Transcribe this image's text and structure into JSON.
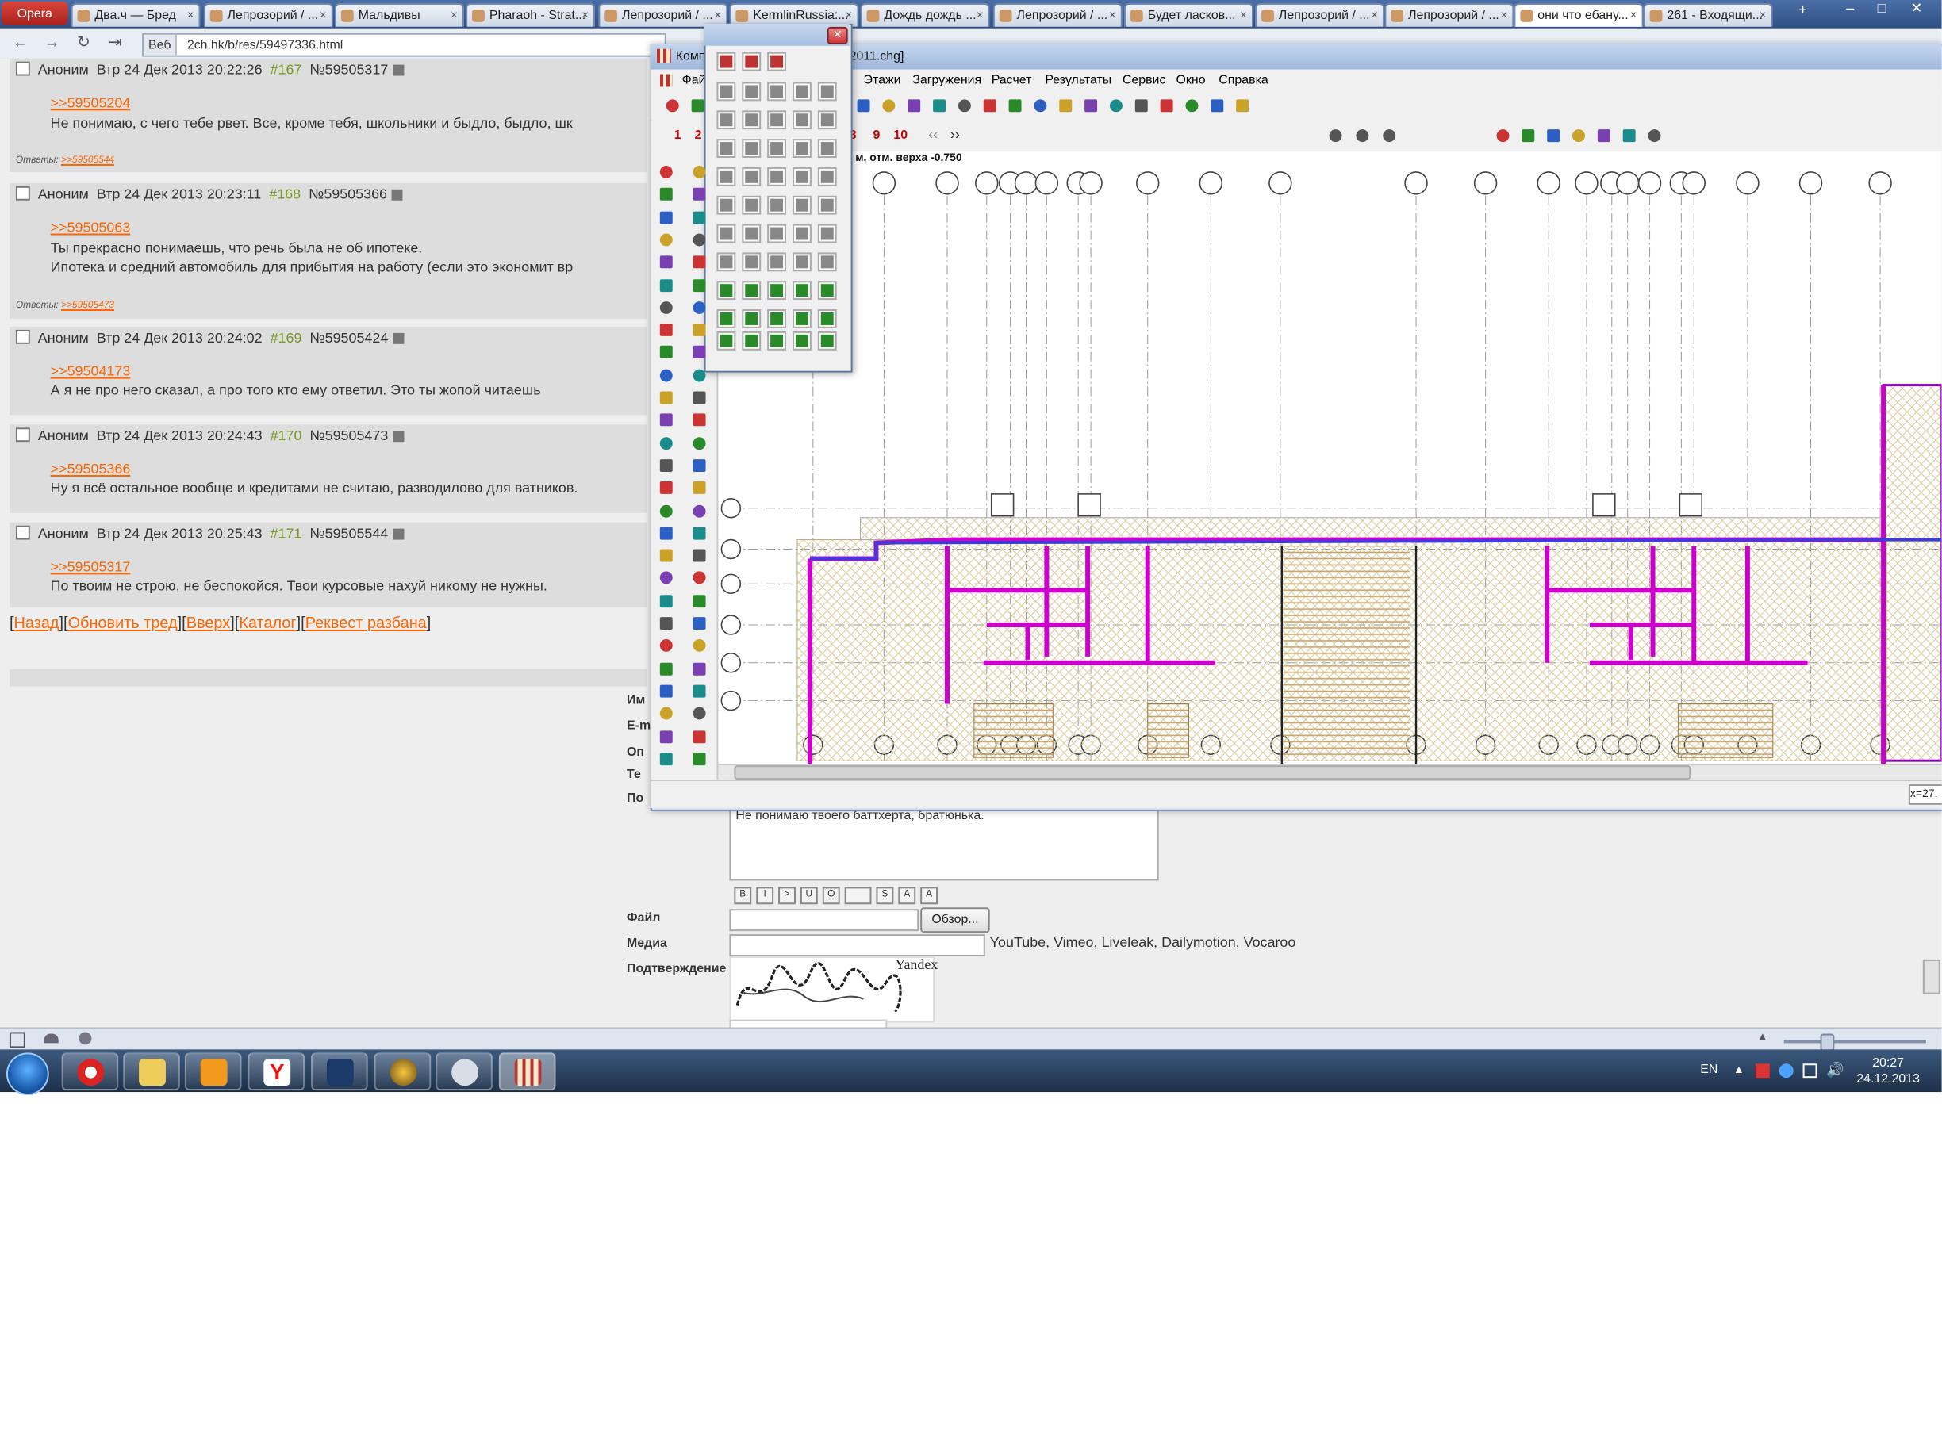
{
  "browser": {
    "app_button": "Opera",
    "tabs": [
      {
        "label": "Два.ч — Бред"
      },
      {
        "label": "Лепрозорий / ..."
      },
      {
        "label": "Мальдивы"
      },
      {
        "label": "Pharaoh - Strat..."
      },
      {
        "label": "Лепрозорий / ..."
      },
      {
        "label": "KermlinRussia:..."
      },
      {
        "label": "Дождь дождь ..."
      },
      {
        "label": "Лепрозорий / ..."
      },
      {
        "label": "Будет ласков..."
      },
      {
        "label": "Лепрозорий / ..."
      },
      {
        "label": "Лепрозорий / ..."
      },
      {
        "label": "они что ебану..."
      },
      {
        "label": "261 - Входящи..."
      }
    ],
    "address_prefix": "Веб",
    "url": "2ch.hk/b/res/59497336.html"
  },
  "posts": [
    {
      "author": "Аноним",
      "date": "Втр 24 Дек 2013 20:22:26",
      "num": "#167",
      "id": "№59505317",
      "ref": ">>59505204",
      "lines": [
        "Не понимаю, с чего тебе рвет. Все, кроме тебя, школьники и быдло, быдло, шк"
      ],
      "replies_label": "Ответы:",
      "replies": ">>59505544"
    },
    {
      "author": "Аноним",
      "date": "Втр 24 Дек 2013 20:23:11",
      "num": "#168",
      "id": "№59505366",
      "ref": ">>59505063",
      "lines": [
        "Ты прекрасно понимаешь, что речь была не об ипотеке.",
        "Ипотека и средний автомобиль для прибытия на работу (если это экономит вр"
      ],
      "replies_label": "Ответы:",
      "replies": ">>59505473"
    },
    {
      "author": "Аноним",
      "date": "Втр 24 Дек 2013 20:24:02",
      "num": "#169",
      "id": "№59505424",
      "ref": ">>59504173",
      "lines": [
        "А я не про него сказал, а про того кто ему ответил. Это ты жопой читаешь"
      ]
    },
    {
      "author": "Аноним",
      "date": "Втр 24 Дек 2013 20:24:43",
      "num": "#170",
      "id": "№59505473",
      "ref": ">>59505366",
      "lines": [
        "Ну я всё остальное вообще и кредитами не считаю, разводилово для ватников."
      ]
    },
    {
      "author": "Аноним",
      "date": "Втр 24 Дек 2013 20:25:43",
      "num": "#171",
      "id": "№59505544",
      "ref": ">>59505317",
      "lines": [
        "По твоим не строю, не беспокойся. Твои курсовые нахуй никому не нужны."
      ]
    }
  ],
  "nav": {
    "back": "Назад",
    "refresh": "Обновить тред",
    "up": "Вверх",
    "catalog": "Каталог",
    "request": "Реквест разбана"
  },
  "form": {
    "label_name": "Им",
    "label_email": "E-m",
    "label_options": "Оп",
    "label_subject": "Те",
    "label_post": "По",
    "comment_text": "Не понимаю твоего баттхерта, братюнька.",
    "label_file": "Файл",
    "browse_button": "Обзор...",
    "label_media": "Медиа",
    "media_sources": "YouTube, Vimeo, Liveleak, Dailymotion, Vocaroo",
    "label_captcha": "Подтверждение",
    "captcha_brand": "Yandex"
  },
  "cad": {
    "title_left": "Комп",
    "title_right": "2011.chg]",
    "menu": [
      "Фай",
      "Этажи",
      "Загружения",
      "Расчет",
      "Результаты",
      "Сервис",
      "Окно",
      "Справка"
    ],
    "floor_numbers": [
      "1",
      "2",
      "8",
      "9",
      "10"
    ],
    "floor_label": "6 м, отм. верха -0.750",
    "coords": "x=27."
  },
  "taskbar": {
    "lang": "EN",
    "time": "20:27",
    "date": "24.12.2013"
  },
  "colors": {
    "link": "#ff6600",
    "walls": "#cc00cc",
    "post_bg": "#dddddd",
    "page_bg": "#eeeeee"
  }
}
